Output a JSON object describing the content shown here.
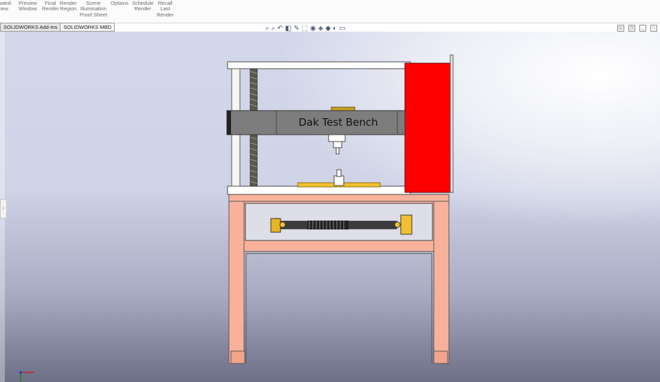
{
  "ribbon": {
    "items": [
      {
        "lines": "pated\niew"
      },
      {
        "lines": "Preview\nWindow"
      },
      {
        "lines": "Final\nRender"
      },
      {
        "lines": "Render\nRegion"
      },
      {
        "lines": "Scene\nIllumination\nProof Sheet"
      },
      {
        "lines": "Options"
      },
      {
        "lines": "Schedule\nRender"
      },
      {
        "lines": "Recall\nLast\nRender"
      }
    ]
  },
  "tabs": [
    {
      "label": "SOLIDWORKS Add-Ins"
    },
    {
      "label": "SOLIDWORKS MBD"
    }
  ],
  "heads_up_toolbar": {
    "icons": [
      "zoom-to-fit-icon",
      "zoom-to-area-icon",
      "previous-view-icon",
      "section-view-icon",
      "dynamic-annotation-icon",
      "view-orientation-icon",
      "display-style-icon",
      "hide-show-items-icon",
      "edit-appearance-icon",
      "apply-scene-icon",
      "view-settings-icon"
    ],
    "glyphs": [
      "⌕",
      "⌕",
      "↶",
      "◧",
      "✎",
      "⬚",
      "◉",
      "◈",
      "◆",
      "◐",
      "▭"
    ]
  },
  "window_controls": {
    "icons": [
      "restore-icon",
      "tile-icon",
      "minimize-icon",
      "maximize-icon"
    ],
    "glyphs": [
      "◱",
      "◳",
      "_",
      "□"
    ]
  },
  "model": {
    "label": "Dak Test Bench",
    "colors": {
      "frame": "#f8b29c",
      "red_panel": "#ff0000",
      "beam": "#7a7a7a",
      "brass": "#f2c030",
      "plate": "#ffffff"
    }
  }
}
